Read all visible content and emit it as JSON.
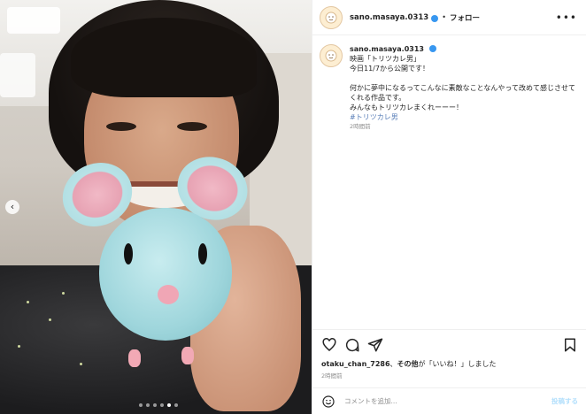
{
  "post": {
    "username": "sano.masaya.0313",
    "separator": "•",
    "follow_label": "フォロー",
    "more_label": "•••",
    "caption_lines": [
      "映画「トリツカレ男」",
      "今日11/7から公開です！"
    ],
    "caption_lines2": [
      "何かに夢中になるってこんなに素敵なことなんやって改めて感じさせてくれる作品です。",
      "みんなもトリツカレまくれーーー！"
    ],
    "hashtag": "#トリツカレ男",
    "caption_time": "2時間前",
    "likes_user": "otaku_chan_7286",
    "likes_middle": "、",
    "likes_bold": "その他",
    "likes_rest": "が「いいね！」しました",
    "post_time": "2時間前",
    "comment_placeholder": "コメントを追加...",
    "post_button": "投稿する"
  },
  "carousel": {
    "prev_icon": "‹",
    "dots": 6,
    "active_dot": 5
  },
  "colors": {
    "verified": "#3897f0",
    "hashtag": "#5a7fb8",
    "post_button": "#b2dffc"
  }
}
